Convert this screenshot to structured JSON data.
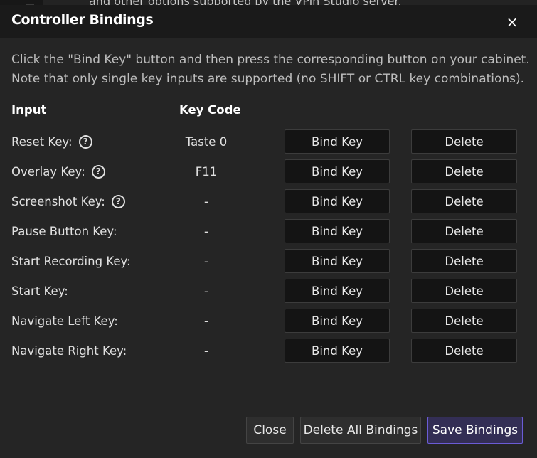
{
  "background": {
    "partial_text": "and other options supported by the VPin Studio server."
  },
  "dialog": {
    "title": "Controller Bindings",
    "close_glyph": "×",
    "description_line1": "Click the \"Bind Key\" button and then press the corresponding button on your cabinet.",
    "description_line2": "Note that only single key inputs are supported (no SHIFT or CTRL key combinations).",
    "headers": {
      "input": "Input",
      "key_code": "Key Code"
    },
    "bind_label": "Bind Key",
    "delete_label": "Delete",
    "help_glyph": "?",
    "rows": [
      {
        "label": "Reset Key:",
        "code": "Taste 0",
        "help": true
      },
      {
        "label": "Overlay Key:",
        "code": "F11",
        "help": true
      },
      {
        "label": "Screenshot Key:",
        "code": "-",
        "help": true
      },
      {
        "label": "Pause Button Key:",
        "code": "-",
        "help": false
      },
      {
        "label": "Start Recording Key:",
        "code": "-",
        "help": false
      },
      {
        "label": "Start Key:",
        "code": "-",
        "help": false
      },
      {
        "label": "Navigate Left Key:",
        "code": "-",
        "help": false
      },
      {
        "label": "Navigate Right Key:",
        "code": "-",
        "help": false
      }
    ],
    "footer": {
      "close_label": "Close",
      "delete_all_label": "Delete All Bindings",
      "save_label": "Save Bindings"
    }
  },
  "colors": {
    "dialog_bg": "#252525",
    "titlebar_bg": "#1a1a1a",
    "button_bg": "#141414",
    "save_accent": "#6b5cd6"
  }
}
